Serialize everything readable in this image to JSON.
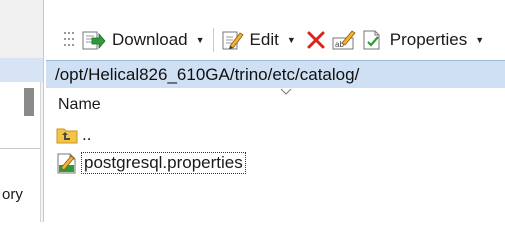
{
  "left_pane": {
    "partial_text": "ory"
  },
  "toolbar": {
    "download_label": "Download",
    "edit_label": "Edit",
    "properties_label": "Properties",
    "dropdown_glyph": "▼"
  },
  "path_bar": {
    "path": "/opt/Helical826_610GA/trino/etc/catalog/"
  },
  "file_list": {
    "column_name": "Name",
    "sort_glyph": "⌄",
    "items": [
      {
        "name": "..",
        "icon": "parent-folder-icon"
      },
      {
        "name": "postgresql.properties",
        "icon": "properties-file-icon",
        "selected": true
      }
    ]
  },
  "colors": {
    "path_bar_bg": "#cfe0f4",
    "delete_red": "#d9261c",
    "download_green": "#2e9a3a"
  }
}
